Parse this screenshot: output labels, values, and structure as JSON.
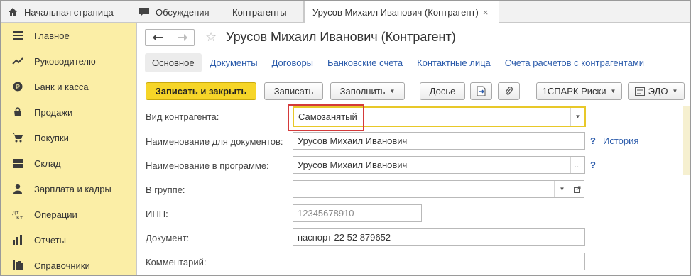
{
  "tabs": [
    {
      "label": "Начальная страница",
      "icon": "home-icon"
    },
    {
      "label": "Обсуждения",
      "icon": "chat-icon"
    },
    {
      "label": "Контрагенты"
    },
    {
      "label": "Урусов Михаил Иванович (Контрагент)",
      "close": "×"
    }
  ],
  "sidebar": {
    "items": [
      {
        "label": "Главное",
        "icon": "menu-icon"
      },
      {
        "label": "Руководителю",
        "icon": "trend-icon"
      },
      {
        "label": "Банк и касса",
        "icon": "coin-icon"
      },
      {
        "label": "Продажи",
        "icon": "bag-icon"
      },
      {
        "label": "Покупки",
        "icon": "cart-icon"
      },
      {
        "label": "Склад",
        "icon": "warehouse-icon"
      },
      {
        "label": "Зарплата и кадры",
        "icon": "person-icon"
      },
      {
        "label": "Операции",
        "icon": "dt-kt-icon"
      },
      {
        "label": "Отчеты",
        "icon": "chart-icon"
      },
      {
        "label": "Справочники",
        "icon": "books-icon"
      }
    ]
  },
  "header": {
    "title": "Урусов Михаил Иванович (Контрагент)"
  },
  "subtabs": [
    "Основное",
    "Документы",
    "Договоры",
    "Банковские счета",
    "Контактные лица",
    "Счета расчетов с контрагентами"
  ],
  "toolbar": {
    "save_close": "Записать и закрыть",
    "save": "Записать",
    "fill": "Заполнить",
    "dossier": "Досье",
    "spark": "1СПАРК Риски",
    "edo": "ЭДО"
  },
  "form": {
    "type_label": "Вид контрагента:",
    "type_value": "Самозанятый",
    "docname_label": "Наименование для документов:",
    "docname_value": "Урусов Михаил Иванович",
    "history_link": "История",
    "progname_label": "Наименование в программе:",
    "progname_value": "Урусов Михаил Иванович",
    "group_label": "В группе:",
    "group_value": "",
    "inn_label": "ИНН:",
    "inn_value": "12345678910",
    "doc_label": "Документ:",
    "doc_value": "паспорт 22 52 879652",
    "comment_label": "Комментарий:",
    "comment_value": "",
    "help": "?",
    "ellipsis": "..."
  },
  "colors": {
    "sidebar_bg": "#fbeea6",
    "primary_btn": "#f6d528",
    "link": "#2b5bab",
    "highlight": "#d43a3a",
    "active_field_border": "#e8c829"
  }
}
